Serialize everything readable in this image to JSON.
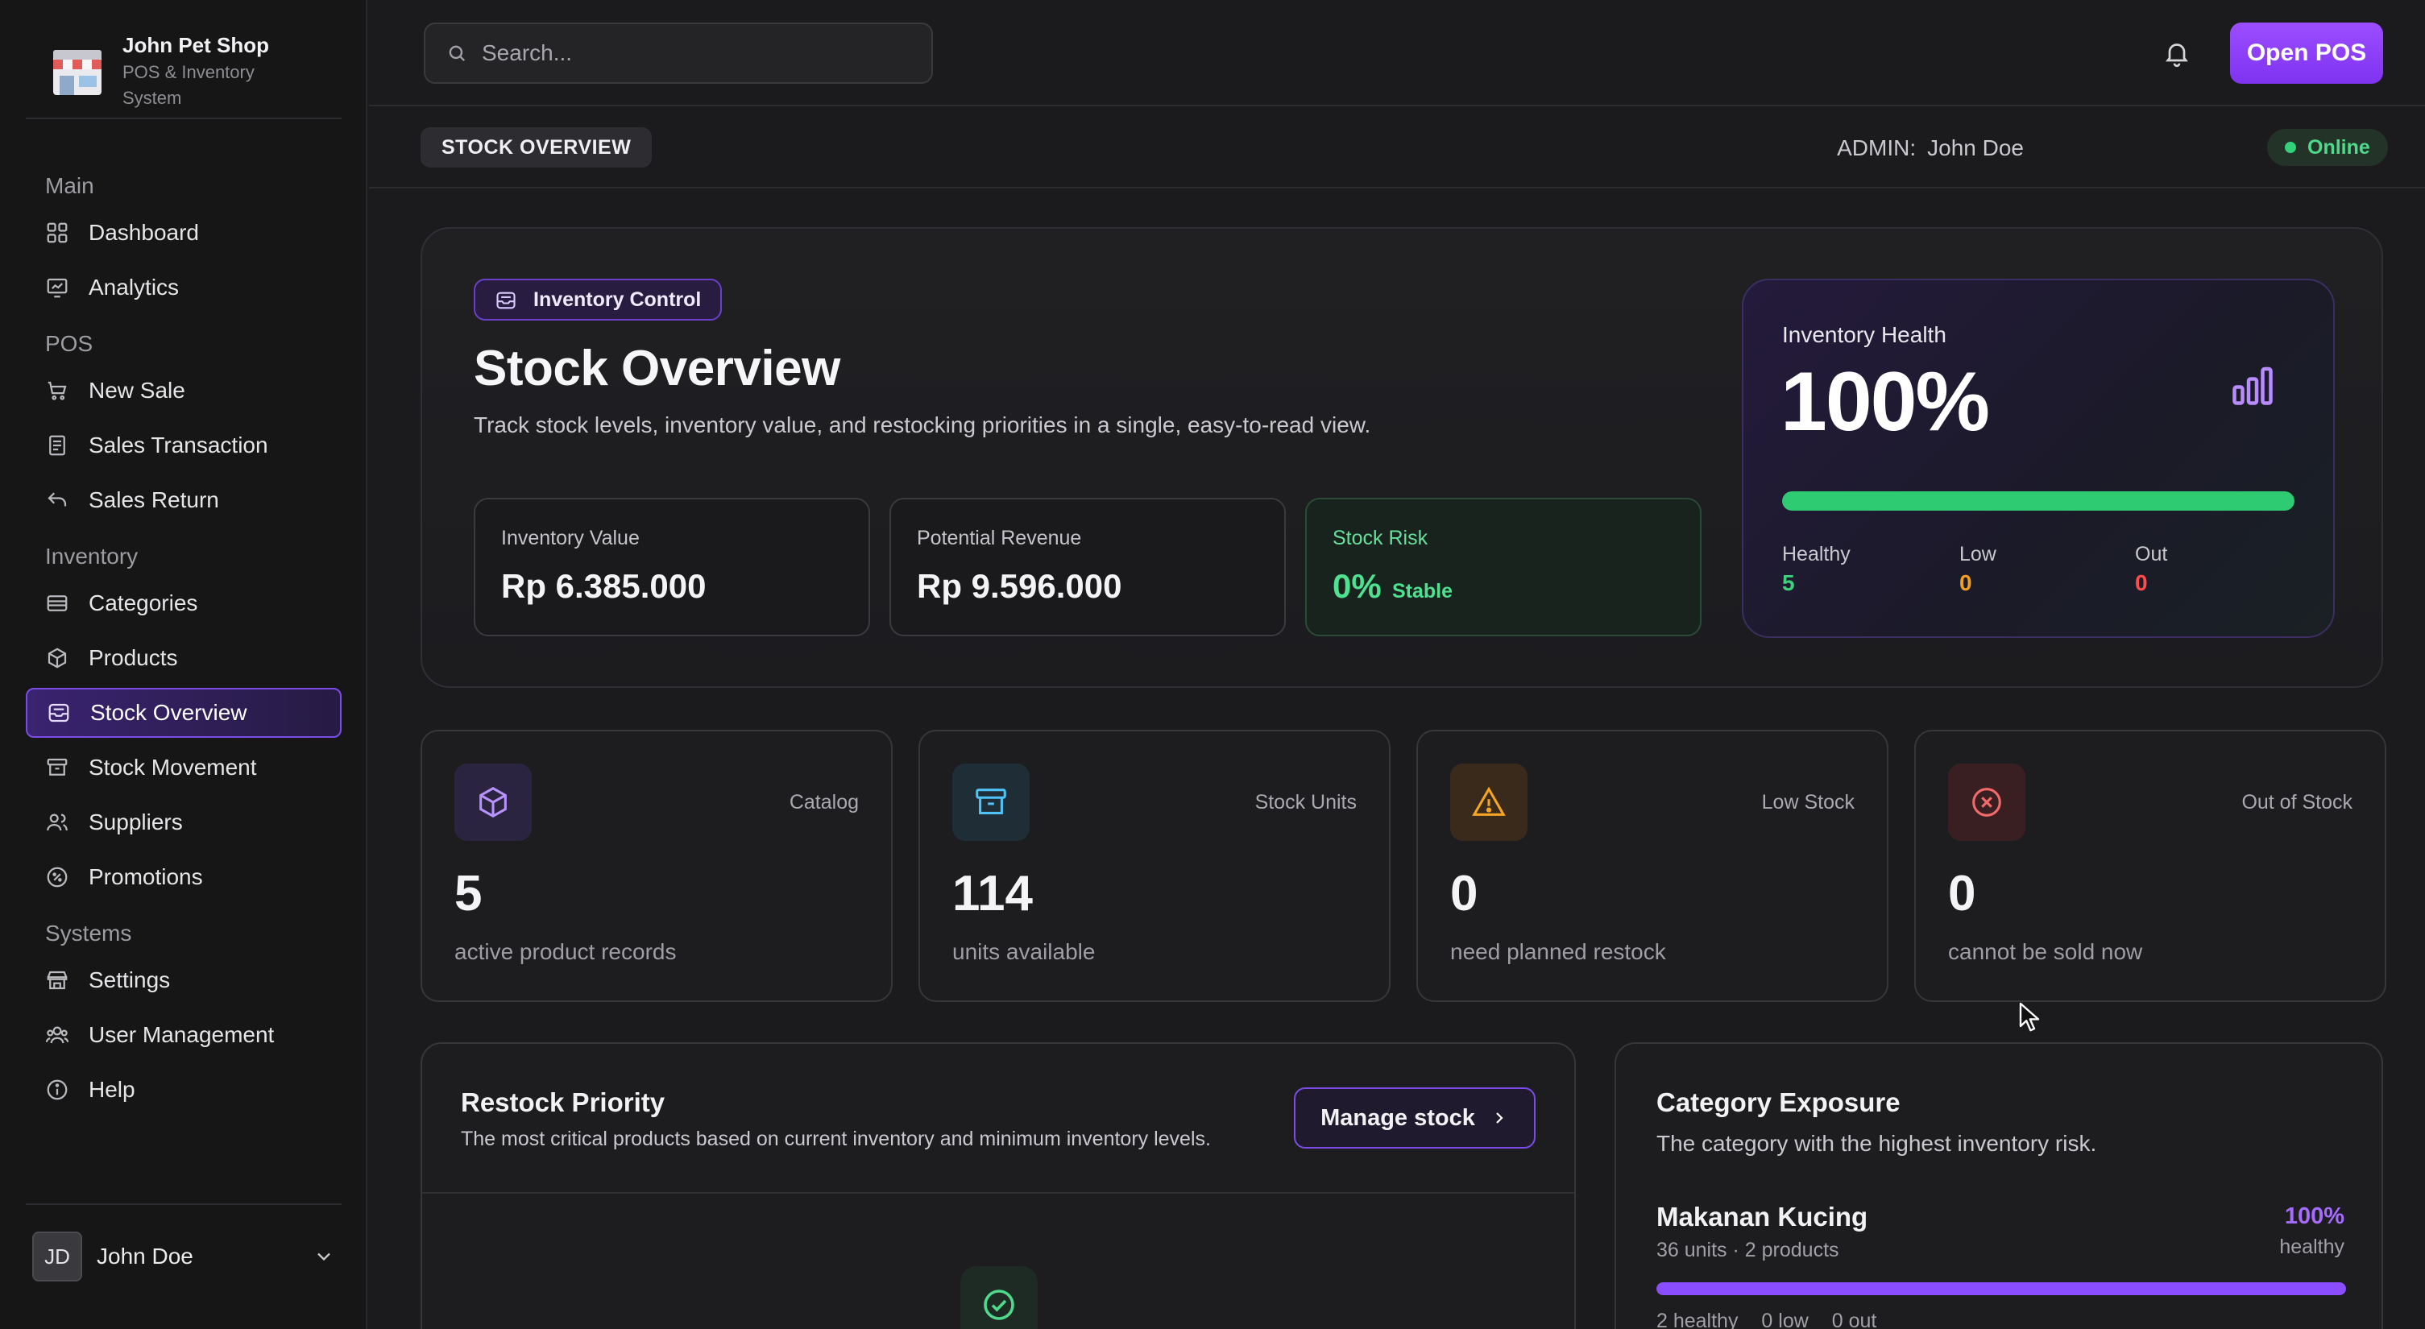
{
  "app": {
    "name": "John Pet Shop",
    "subtitle": "POS & Inventory System"
  },
  "sidebar": {
    "sections": [
      {
        "label": "Main",
        "items": [
          {
            "label": "Dashboard",
            "icon": "dashboard-icon"
          },
          {
            "label": "Analytics",
            "icon": "analytics-icon"
          }
        ]
      },
      {
        "label": "POS",
        "items": [
          {
            "label": "New Sale",
            "icon": "cart-icon"
          },
          {
            "label": "Sales Transaction",
            "icon": "receipt-icon"
          },
          {
            "label": "Sales Return",
            "icon": "return-icon"
          }
        ]
      },
      {
        "label": "Inventory",
        "items": [
          {
            "label": "Categories",
            "icon": "layers-icon"
          },
          {
            "label": "Products",
            "icon": "box-icon"
          },
          {
            "label": "Stock Overview",
            "icon": "inbox-icon",
            "active": true
          },
          {
            "label": "Stock Movement",
            "icon": "archive-icon"
          },
          {
            "label": "Suppliers",
            "icon": "users-icon"
          },
          {
            "label": "Promotions",
            "icon": "percent-icon"
          }
        ]
      },
      {
        "label": "Systems",
        "items": [
          {
            "label": "Settings",
            "icon": "store-icon"
          },
          {
            "label": "User Management",
            "icon": "user-group-icon"
          },
          {
            "label": "Help",
            "icon": "info-icon"
          }
        ]
      }
    ],
    "user": {
      "initials": "JD",
      "name": "John Doe"
    }
  },
  "topbar": {
    "search_placeholder": "Search...",
    "open_pos_label": "Open POS"
  },
  "pagebar": {
    "breadcrumb": "STOCK OVERVIEW",
    "admin_label": "ADMIN:",
    "admin_name": "John Doe",
    "status": "Online",
    "status_color": "#33d17a"
  },
  "hero": {
    "badge": "Inventory Control",
    "title": "Stock Overview",
    "description": "Track stock levels, inventory value, and restocking priorities in a single, easy-to-read view.",
    "metrics": [
      {
        "label": "Inventory Value",
        "value": "Rp 6.385.000"
      },
      {
        "label": "Potential Revenue",
        "value": "Rp 9.596.000"
      },
      {
        "label": "Stock Risk",
        "value": "0%",
        "sub": "Stable"
      }
    ],
    "health": {
      "label": "Inventory Health",
      "value": "100%",
      "fraction": 1.0,
      "cols": [
        {
          "label": "Healthy",
          "value": "5",
          "color": "#3fd07e"
        },
        {
          "label": "Low",
          "value": "0",
          "color": "#f0a020"
        },
        {
          "label": "Out",
          "value": "0",
          "color": "#ff4d4d"
        }
      ]
    }
  },
  "stats": [
    {
      "tag": "Catalog",
      "value": "5",
      "desc": "active product records",
      "icon": "cube-icon",
      "tile": "#2b2440",
      "icon_color": "#b892ff"
    },
    {
      "tag": "Stock Units",
      "value": "114",
      "desc": "units available",
      "icon": "archive-box-icon",
      "tile": "#1f2e36",
      "icon_color": "#4fc3f7"
    },
    {
      "tag": "Low Stock",
      "value": "0",
      "desc": "need planned restock",
      "icon": "warning-icon",
      "tile": "#3a2a1c",
      "icon_color": "#f5a524"
    },
    {
      "tag": "Out of Stock",
      "value": "0",
      "desc": "cannot be sold now",
      "icon": "x-circle-icon",
      "tile": "#3a1f22",
      "icon_color": "#f26b6b"
    }
  ],
  "restock": {
    "title": "Restock Priority",
    "description": "The most critical products based on current inventory and minimum inventory levels.",
    "button": "Manage stock"
  },
  "category": {
    "title": "Category Exposure",
    "description": "The category with the highest inventory risk.",
    "name": "Makanan Kucing",
    "meta": "36 units · 2 products",
    "percent": "100%",
    "percent_label": "healthy",
    "fraction": 1.0,
    "foot": [
      "2 healthy",
      "0 low",
      "0 out"
    ]
  }
}
